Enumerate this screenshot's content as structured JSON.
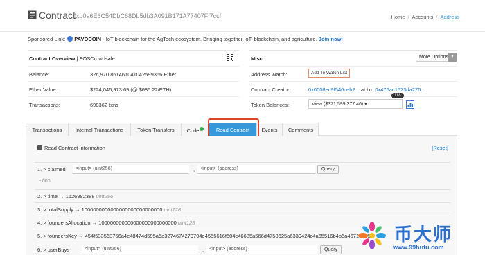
{
  "header": {
    "title": "Contract",
    "address": "0xd0a6E6C54DbC68Db5db3A091B171A77407Ff7ccf",
    "breadcrumb": [
      "Home",
      "Accounts",
      "Address"
    ]
  },
  "sponsored": {
    "label": "Sponsored Link:",
    "brand": "PAVOCOIN",
    "text": " - IoT blockchain for the AgTech ecosystem. Bringing together IoT, blockchain, and agriculture.",
    "cta": "Join now!"
  },
  "overview": {
    "title": "Contract Overview",
    "subtitle": "| EOSCrowdsale",
    "rows": [
      {
        "key": "Balance:",
        "value": "326,970.861461041042599366 Ether"
      },
      {
        "key": "Ether Value:",
        "value": "$224,046,973.69 (@ $685.22/ETH)"
      },
      {
        "key": "Transactions:",
        "value": "698362 txns"
      }
    ]
  },
  "misc": {
    "title": "Misc",
    "more_options": "More Options",
    "address_watch_label": "Address Watch:",
    "add_watch": "Add To Watch List",
    "creator_label": "Contract Creator:",
    "creator_addr": "0x0008ec9f540ceb2...",
    "at_txn": "at txn",
    "creator_txn": "0x476ac1573da276...",
    "token_label": "Token Balances:",
    "token_select": "View ($371,599,377.46) ▾",
    "token_badge": "118"
  },
  "tabs": [
    "Transactions",
    "Internal Transactions",
    "Token Transfers",
    "Code",
    "Read Contract",
    "Events",
    "Comments"
  ],
  "read_contract": {
    "title": "Read Contract Information",
    "reset": "[Reset]",
    "functions": {
      "f1": {
        "label": "1. > claimed",
        "in1": "<input> (uint256)",
        "in2": "<input> (address)",
        "query": "Query",
        "ret": "bool"
      },
      "f2": {
        "label": "2. > time",
        "arrow": "→",
        "value": "1526982388",
        "type": "uint256"
      },
      "f3": {
        "label": "3. > totalSupply",
        "arrow": "→",
        "value": "1000000000000000000000000000",
        "type": "uint128"
      },
      "f4": {
        "label": "4. > foundersAllocation",
        "arrow": "→",
        "value": "100000000000000000000000000",
        "type": "uint128"
      },
      "f5": {
        "label": "5. > foundersKey",
        "arrow": "→",
        "value": "454f533563756a4e48474d595a5a3274674279794e4555616f504c46685a566d4758625a6339424c4a65516b4b5a46714759"
      },
      "f6": {
        "label": "6. > userBuys",
        "in1": "<input> (uint256)",
        "in2": "<input> (address)",
        "query": "Query"
      }
    }
  },
  "watermark": {
    "text": "币大师",
    "url": "www.99hufu.com"
  }
}
